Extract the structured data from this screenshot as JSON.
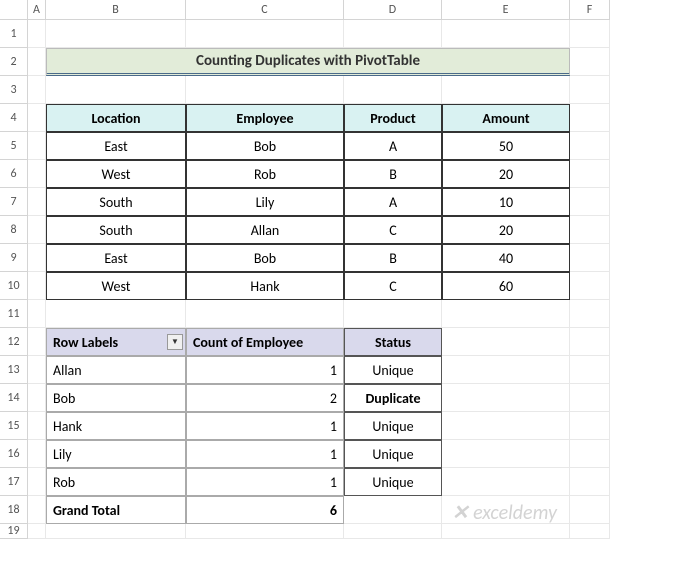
{
  "columns": [
    "",
    "A",
    "B",
    "C",
    "D",
    "E",
    "F"
  ],
  "rows": [
    "1",
    "2",
    "3",
    "4",
    "5",
    "6",
    "7",
    "8",
    "9",
    "10",
    "11",
    "12",
    "13",
    "14",
    "15",
    "16",
    "17",
    "18",
    "19"
  ],
  "title": "Counting Duplicates with PivotTable",
  "table1": {
    "headers": [
      "Location",
      "Employee",
      "Product",
      "Amount"
    ],
    "rows": [
      [
        "East",
        "Bob",
        "A",
        "50"
      ],
      [
        "West",
        "Rob",
        "B",
        "20"
      ],
      [
        "South",
        "Lily",
        "A",
        "10"
      ],
      [
        "South",
        "Allan",
        "C",
        "20"
      ],
      [
        "East",
        "Bob",
        "B",
        "40"
      ],
      [
        "West",
        "Hank",
        "C",
        "60"
      ]
    ]
  },
  "pivot": {
    "row_labels_header": "Row Labels",
    "count_header": "Count of Employee",
    "status_header": "Status",
    "rows": [
      {
        "label": "Allan",
        "count": "1",
        "status": "Unique"
      },
      {
        "label": "Bob",
        "count": "2",
        "status": "Duplicate"
      },
      {
        "label": "Hank",
        "count": "1",
        "status": "Unique"
      },
      {
        "label": "Lily",
        "count": "1",
        "status": "Unique"
      },
      {
        "label": "Rob",
        "count": "1",
        "status": "Unique"
      }
    ],
    "grand_label": "Grand Total",
    "grand_count": "6"
  },
  "watermark": "exceldemy"
}
